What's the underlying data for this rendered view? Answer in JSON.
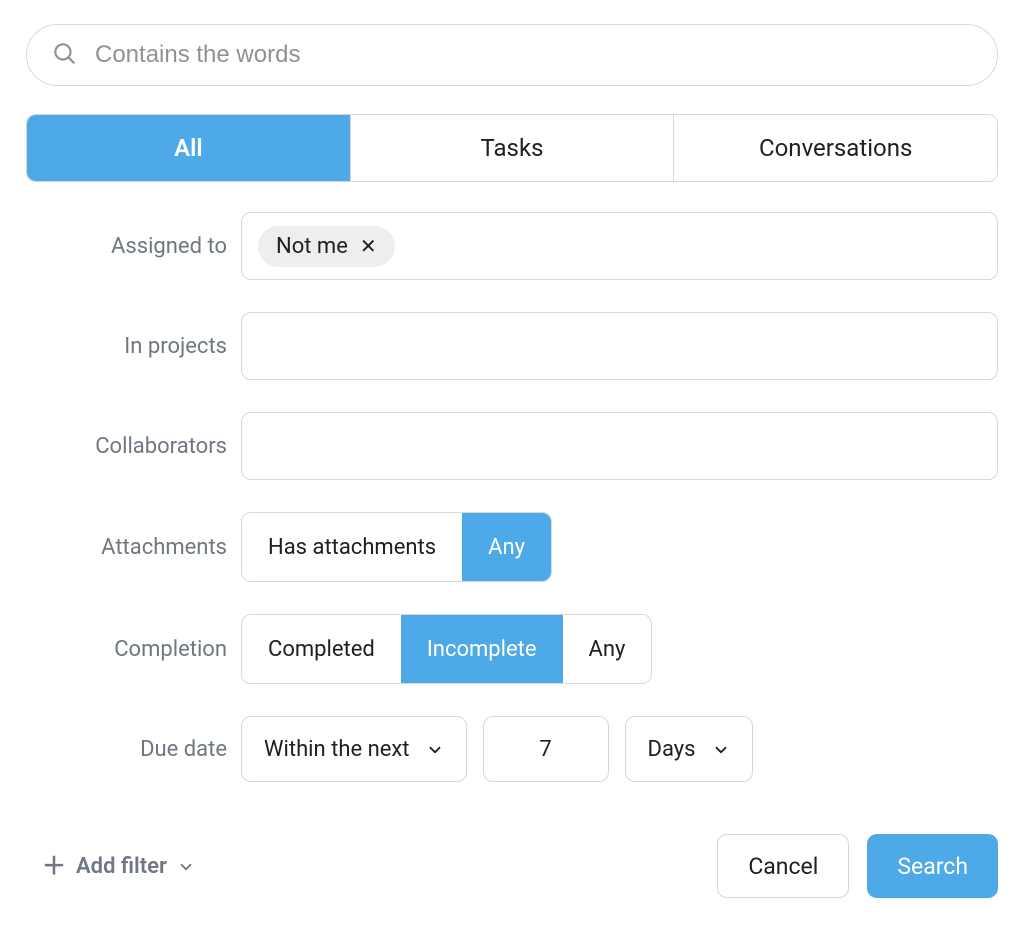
{
  "search": {
    "placeholder": "Contains the words",
    "value": ""
  },
  "scope_tabs": [
    {
      "label": "All",
      "active": true
    },
    {
      "label": "Tasks",
      "active": false
    },
    {
      "label": "Conversations",
      "active": false
    }
  ],
  "filters": {
    "assigned_to": {
      "label": "Assigned to",
      "chips": [
        {
          "text": "Not me"
        }
      ]
    },
    "in_projects": {
      "label": "In projects"
    },
    "collaborators": {
      "label": "Collaborators"
    },
    "attachments": {
      "label": "Attachments",
      "options": [
        {
          "text": "Has attachments",
          "active": false
        },
        {
          "text": "Any",
          "active": true
        }
      ]
    },
    "completion": {
      "label": "Completion",
      "options": [
        {
          "text": "Completed",
          "active": false
        },
        {
          "text": "Incomplete",
          "active": true
        },
        {
          "text": "Any",
          "active": false
        }
      ]
    },
    "due_date": {
      "label": "Due date",
      "range_select": "Within the next",
      "value": "7",
      "unit_select": "Days"
    }
  },
  "footer": {
    "add_filter": "Add filter",
    "cancel": "Cancel",
    "search": "Search"
  }
}
